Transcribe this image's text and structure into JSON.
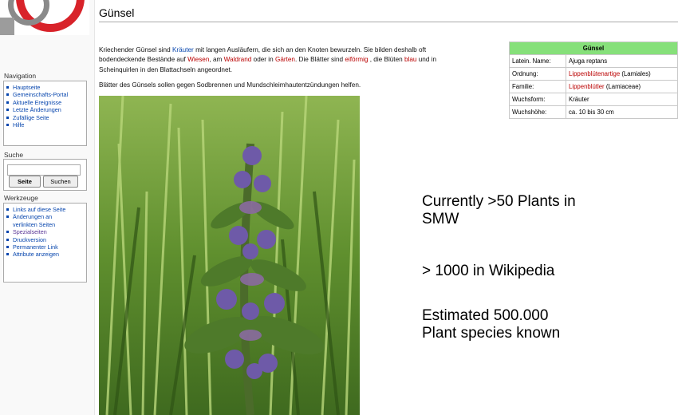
{
  "navigation": {
    "title": "Navigation",
    "items": [
      "Hauptseite",
      "Gemeinschafts-Portal",
      "Aktuelle Ereignisse",
      "Letzte Änderungen",
      "Zufällige Seite",
      "Hilfe"
    ]
  },
  "search": {
    "title": "Suche",
    "go_label": "Seite",
    "search_label": "Suchen"
  },
  "tools": {
    "title": "Werkzeuge",
    "items": [
      "Links auf diese Seite",
      "Änderungen an",
      "verlinkten Seiten",
      "Spezialseiten",
      "Druckversion",
      "Permanenter Link",
      "Attribute anzeigen"
    ]
  },
  "article": {
    "title": "Günsel",
    "p1_a": "Kriechender Günsel sind ",
    "p1_link_kraeuter": "Kräuter",
    "p1_b": " mit langen Ausläufern, die sich an den Knoten bewurzeln. Sie bilden deshalb oft",
    "p1_c": "bodendeckende Bestände auf ",
    "p1_link_wiesen": "Wiesen",
    "p1_d": ", am ",
    "p1_link_waldrand": "Waldrand",
    "p1_e": " oder in ",
    "p1_link_gaerten": "Gärten",
    "p1_f": ". Die Blätter sind ",
    "p1_link_eifoermig": "eiförmig",
    "p1_g": " , die Blüten ",
    "p1_link_blau": "blau",
    "p1_h": " und in",
    "p1_i": "Scheinquirlen in den Blattachseln angeordnet.",
    "p2": "Blätter des Günsels sollen gegen Sodbrennen und Mundschleimhautentzündungen helfen."
  },
  "infobox": {
    "title": "Günsel",
    "rows": [
      {
        "label": "Latein. Name:",
        "value": "Ajuga reptans",
        "link": "",
        "suffix": ""
      },
      {
        "label": "Ordnung:",
        "value": "",
        "link": "Lippenblütenartige",
        "suffix": " (Lamiales)"
      },
      {
        "label": "Familie:",
        "value": "",
        "link": "Lippenblütler",
        "suffix": " (Lamiaceae)"
      },
      {
        "label": "Wuchsform:",
        "value": "Kräuter",
        "link": "",
        "suffix": ""
      },
      {
        "label": "Wuchshöhe:",
        "value": "ca. 10 bis 30 cm",
        "link": "",
        "suffix": ""
      }
    ]
  },
  "slide_notes": {
    "line1a": "Currently >50 Plants in",
    "line1b": "SMW",
    "line2": "> 1000 in Wikipedia",
    "line3a": "Estimated 500.000",
    "line3b": "Plant species known"
  },
  "colors": {
    "link_blue": "#0645ad",
    "link_red": "#ba0000",
    "infobox_header": "#86e07a"
  }
}
